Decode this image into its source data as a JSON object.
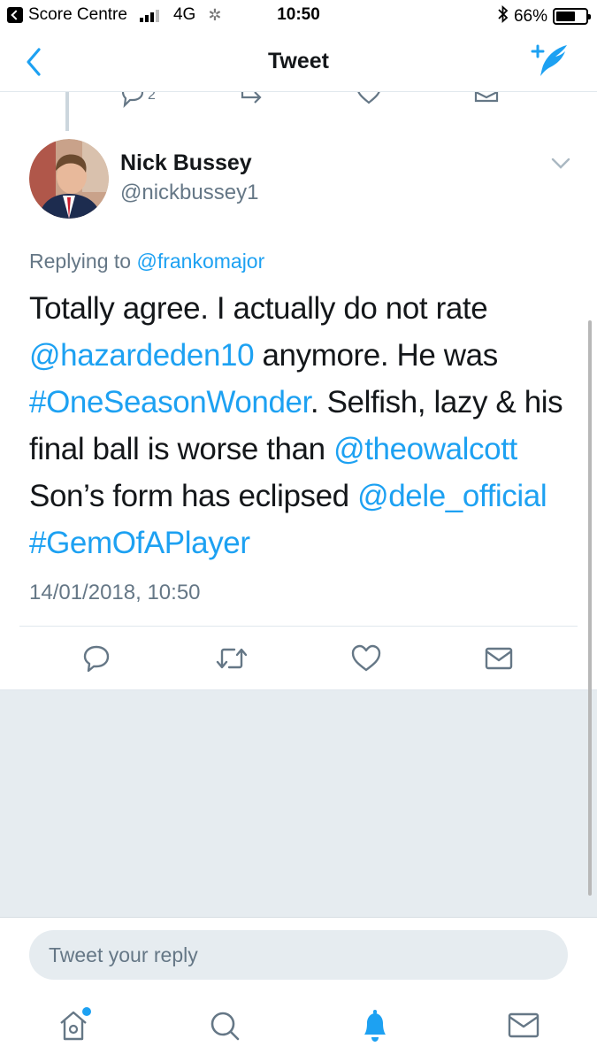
{
  "status_bar": {
    "back_app": "Score Centre",
    "network": "4G",
    "time": "10:50",
    "battery": "66%",
    "battery_level": 0.66
  },
  "nav": {
    "title": "Tweet",
    "back_icon": "chevron-left-icon",
    "compose_icon": "compose-feather-icon"
  },
  "previous_tweet": {
    "reply_count": "2"
  },
  "tweet": {
    "name": "Nick Bussey",
    "handle": "@nickbussey1",
    "replying_label": "Replying to",
    "replying_to": "@frankomajor",
    "text": {
      "t1": "Totally agree. I actually do not rate ",
      "m1": "@hazardeden10",
      "t2": " anymore. He was ",
      "h1": "#OneSeasonWonder",
      "t3": ". Selfish, lazy & his final ball is worse than ",
      "m2": "@theowalcott",
      "t4": " Son’s form has eclipsed ",
      "m3": "@dele_official",
      "h2": "#GemOfAPlayer"
    },
    "timestamp": "14/01/2018, 10:50"
  },
  "reply": {
    "placeholder": "Tweet your reply"
  },
  "tabs": [
    "home-icon",
    "search-icon",
    "notifications-icon",
    "messages-icon"
  ],
  "colors": {
    "accent": "#1da1f2",
    "text": "#14171a",
    "secondary": "#657786",
    "background_grey": "#e6ecf0"
  }
}
